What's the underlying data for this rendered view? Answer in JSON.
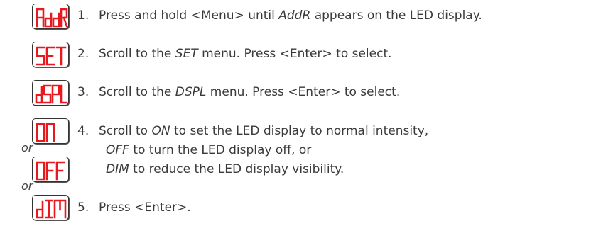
{
  "displays": [
    {
      "code": "AddR"
    },
    {
      "code": "SET"
    },
    {
      "code": "dSPL"
    },
    {
      "code": "ON"
    },
    {
      "code": "OFF"
    },
    {
      "code": "dIM"
    }
  ],
  "led_color": "#e8191e",
  "or_label": "or",
  "steps": [
    {
      "num": "1.",
      "pre": "Press and hold <Menu> until ",
      "em": "AddR",
      "post": " appears on the LED display."
    },
    {
      "num": "2.",
      "pre": "Scroll to the ",
      "em": "SET",
      "post": " menu. Press <Enter> to select."
    },
    {
      "num": "3.",
      "pre": "Scroll to the ",
      "em": "DSPL",
      "post": " menu. Press <Enter> to select."
    },
    {
      "num": "4.",
      "pre": "Scroll to ",
      "em": "ON",
      "post": " to set the LED display to normal intensity,"
    },
    {
      "num": "5.",
      "pre": "Press <Enter>.",
      "em": "",
      "post": ""
    }
  ],
  "step4_lines": [
    {
      "em": "OFF",
      "post": " to turn the LED display off, or"
    },
    {
      "em": "DIM",
      "post": " to reduce the LED display visibility."
    }
  ]
}
